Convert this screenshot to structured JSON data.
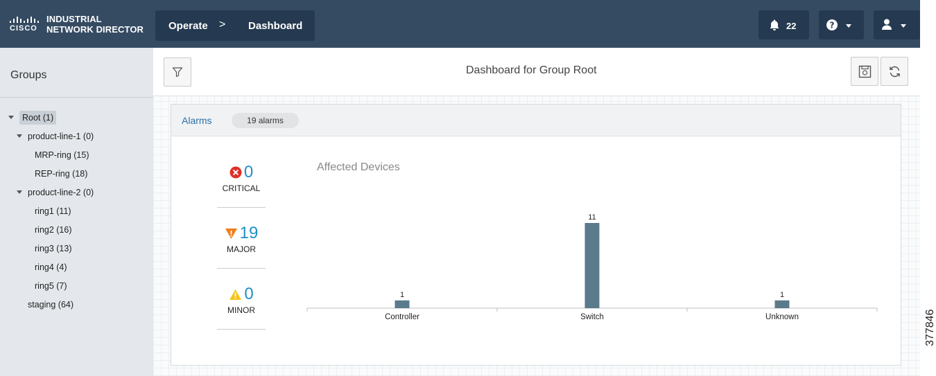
{
  "header": {
    "brand_sub": "CISCO",
    "product_line1": "INDUSTRIAL",
    "product_line2": "NETWORK DIRECTOR",
    "breadcrumb": [
      "Operate",
      "Dashboard"
    ],
    "breadcrumb_separator": ">",
    "notification_count": "22",
    "bg_color": "#354b62",
    "button_color": "#253a50"
  },
  "sidebar": {
    "title": "Groups",
    "items": [
      {
        "label": "Root (1)",
        "level": 0,
        "expanded": true,
        "selected": true
      },
      {
        "label": "product-line-1 (0)",
        "level": 1,
        "expanded": true
      },
      {
        "label": "MRP-ring (15)",
        "level": 2
      },
      {
        "label": "REP-ring (18)",
        "level": 2
      },
      {
        "label": "product-line-2 (0)",
        "level": 1,
        "expanded": true
      },
      {
        "label": "ring1 (11)",
        "level": 2
      },
      {
        "label": "ring2 (16)",
        "level": 2
      },
      {
        "label": "ring3 (13)",
        "level": 2
      },
      {
        "label": "ring4 (4)",
        "level": 2
      },
      {
        "label": "ring5 (7)",
        "level": 2
      },
      {
        "label": "staging (64)",
        "level": 1
      }
    ]
  },
  "toolbar": {
    "title": "Dashboard for Group Root"
  },
  "alarms_panel": {
    "tab_label": "Alarms",
    "count_badge": "19 alarms",
    "severities": [
      {
        "name": "CRITICAL",
        "count": "0",
        "icon": "critical-icon",
        "color": "#e0302b"
      },
      {
        "name": "MAJOR",
        "count": "19",
        "icon": "major-icon",
        "color": "#f07f1b"
      },
      {
        "name": "MINOR",
        "count": "0",
        "icon": "minor-icon",
        "color": "#f5c518"
      }
    ],
    "count_color": "#1f8fc8"
  },
  "chart_data": {
    "type": "bar",
    "title": "Affected Devices",
    "categories": [
      "Controller",
      "Switch",
      "Unknown"
    ],
    "values": [
      1,
      11,
      1
    ],
    "bar_color": "#5b7a8c",
    "grid": false
  },
  "side_watermark": "377846"
}
